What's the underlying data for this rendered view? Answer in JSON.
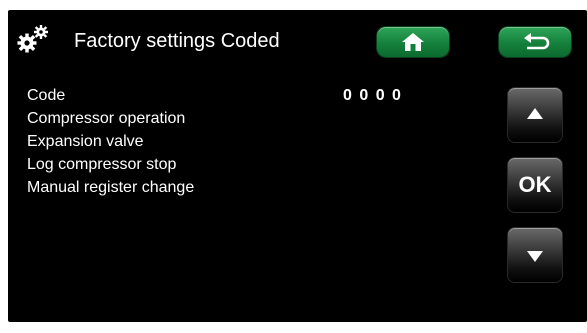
{
  "header": {
    "title": "Factory settings Coded",
    "settings_icon": "gears-icon",
    "home_icon": "home-icon",
    "back_icon": "back-arrow-icon"
  },
  "menu": {
    "items": [
      {
        "label": "Code",
        "value": "0 0 0 0"
      },
      {
        "label": "Compressor operation"
      },
      {
        "label": "Expansion valve"
      },
      {
        "label": "Log compressor stop"
      },
      {
        "label": "Manual register change"
      }
    ]
  },
  "side_buttons": {
    "up_icon": "up-arrow-icon",
    "ok_label": "OK",
    "down_icon": "down-arrow-icon"
  },
  "colors": {
    "background": "#000000",
    "text": "#ffffff",
    "nav_button": "#1a8a42"
  }
}
